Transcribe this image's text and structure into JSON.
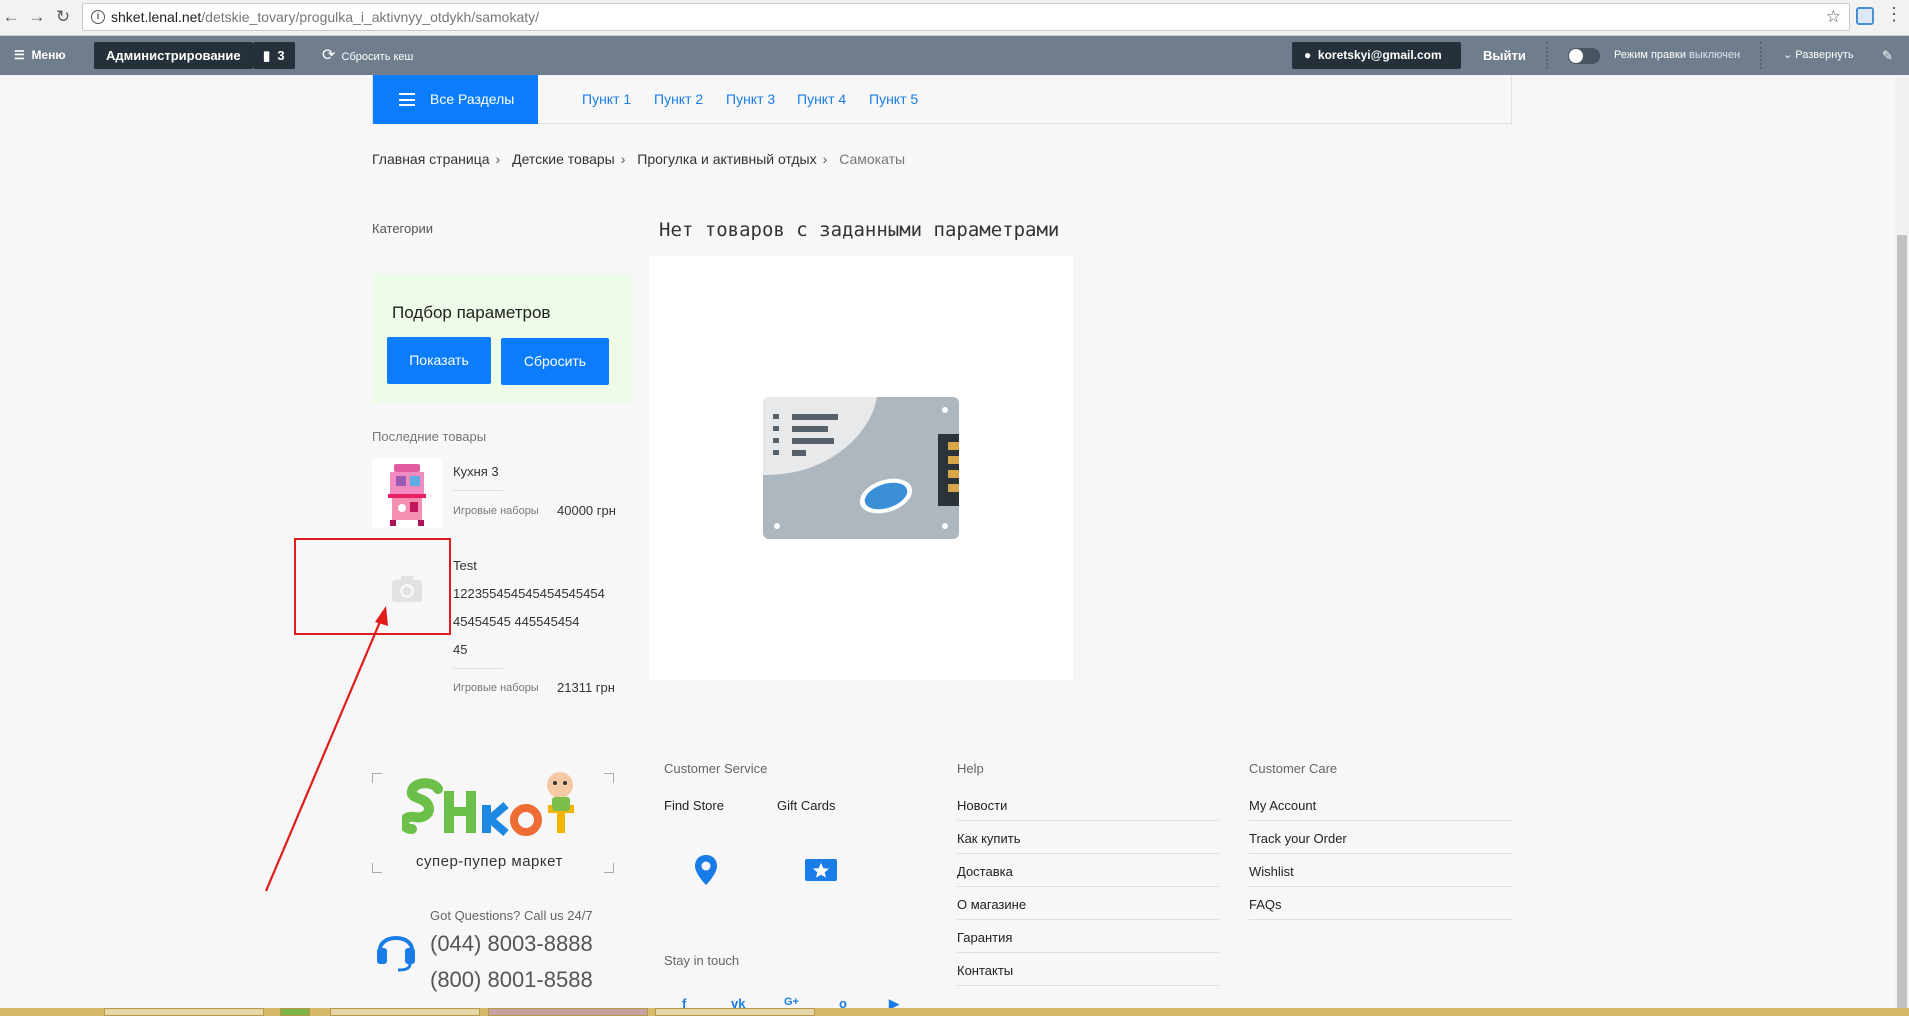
{
  "browser": {
    "url_host": "shket.lenal.net",
    "url_path": "/detskie_tovary/progulka_i_aktivnyy_otdykh/samokaty/"
  },
  "admin_panel": {
    "menu": "Меню",
    "administration": "Администрирование",
    "notifications_count": "3",
    "clear_cache": "Сбросить кеш",
    "user_email": "koretskyi@gmail.com",
    "logout": "Выйти",
    "edit_mode_label": "Режим правки",
    "edit_mode_state": "выключен",
    "expand": "Развернуть"
  },
  "top_nav": {
    "all_sections": "Все Разделы",
    "items": [
      "Пункт 1",
      "Пункт 2",
      "Пункт 3",
      "Пункт 4",
      "Пункт 5"
    ]
  },
  "breadcrumb": {
    "items": [
      "Главная страница",
      "Детские товары",
      "Прогулка и активный отдых"
    ],
    "current": "Самокаты"
  },
  "sidebar": {
    "categories_title": "Категории",
    "filter_title": "Подбор параметров",
    "show_button": "Показать",
    "reset_button": "Сбросить",
    "recent_title": "Последние товары",
    "products": [
      {
        "name_lines": [
          "Кухня 3"
        ],
        "category": "Игровые наборы",
        "price": "40000 грн"
      },
      {
        "name_lines": [
          "Test",
          "122355454545454545454",
          "45454545 445545454",
          "45"
        ],
        "category": "Игровые наборы",
        "price": "21311 грн"
      }
    ]
  },
  "main": {
    "no_goods": "Нет товаров с заданными параметрами"
  },
  "footer": {
    "logo_tagline": "супер-пупер маркет",
    "got_questions": "Got Questions? Call us 24/7",
    "phone_1": "(044) 8003-8888",
    "phone_2": "(800) 8001-8588",
    "customer_service": {
      "title": "Customer Service",
      "find_store": "Find Store",
      "gift_cards": "Gift Cards"
    },
    "stay_in_touch": "Stay in touch",
    "help": {
      "title": "Help",
      "links": [
        "Новости",
        "Как купить",
        "Доставка",
        "О магазине",
        "Гарантия",
        "Контакты"
      ]
    },
    "customer_care": {
      "title": "Customer Care",
      "links": [
        "My Account",
        "Track your Order",
        "Wishlist",
        "FAQs"
      ]
    }
  },
  "colors": {
    "accent": "#0a7cfc",
    "admin_bar": "#6f7d8c",
    "annotation": "#e01b1b"
  }
}
